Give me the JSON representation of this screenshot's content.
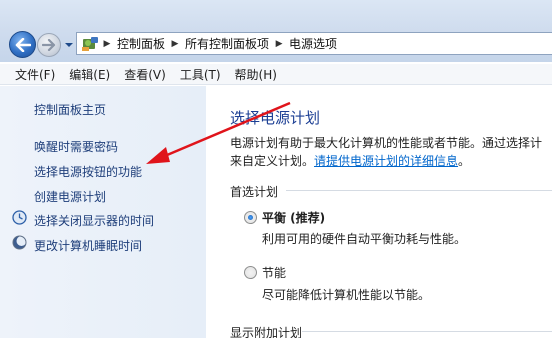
{
  "address_bar": {
    "breadcrumbs": [
      "控制面板",
      "所有控制面板项",
      "电源选项"
    ]
  },
  "menu": [
    "文件(F)",
    "编辑(E)",
    "查看(V)",
    "工具(T)",
    "帮助(H)"
  ],
  "left_pane": {
    "home_link": "控制面板主页",
    "links": [
      "唤醒时需要密码",
      "选择电源按钮的功能",
      "创建电源计划",
      "选择关闭显示器的时间",
      "更改计算机睡眠时间"
    ]
  },
  "main": {
    "title": "选择电源计划",
    "description_line1": "电源计划有助于最大化计算机的性能或者节能。通过选择计",
    "description_line2_prefix": "来自定义计划。",
    "description_link": "请提供电源计划的详细信息",
    "description_line2_suffix": "。",
    "preferred_section": "首选计划",
    "plans": [
      {
        "name": "平衡 (推荐)",
        "description": "利用可用的硬件自动平衡功耗与性能。",
        "selected": true
      },
      {
        "name": "节能",
        "description": "尽可能降低计算机性能以节能。",
        "selected": false
      }
    ],
    "additional_section": "显示附加计划"
  },
  "colors": {
    "title_blue": "#1c3f94",
    "link_blue": "#0066cc",
    "annotation_red": "#e0141b"
  }
}
